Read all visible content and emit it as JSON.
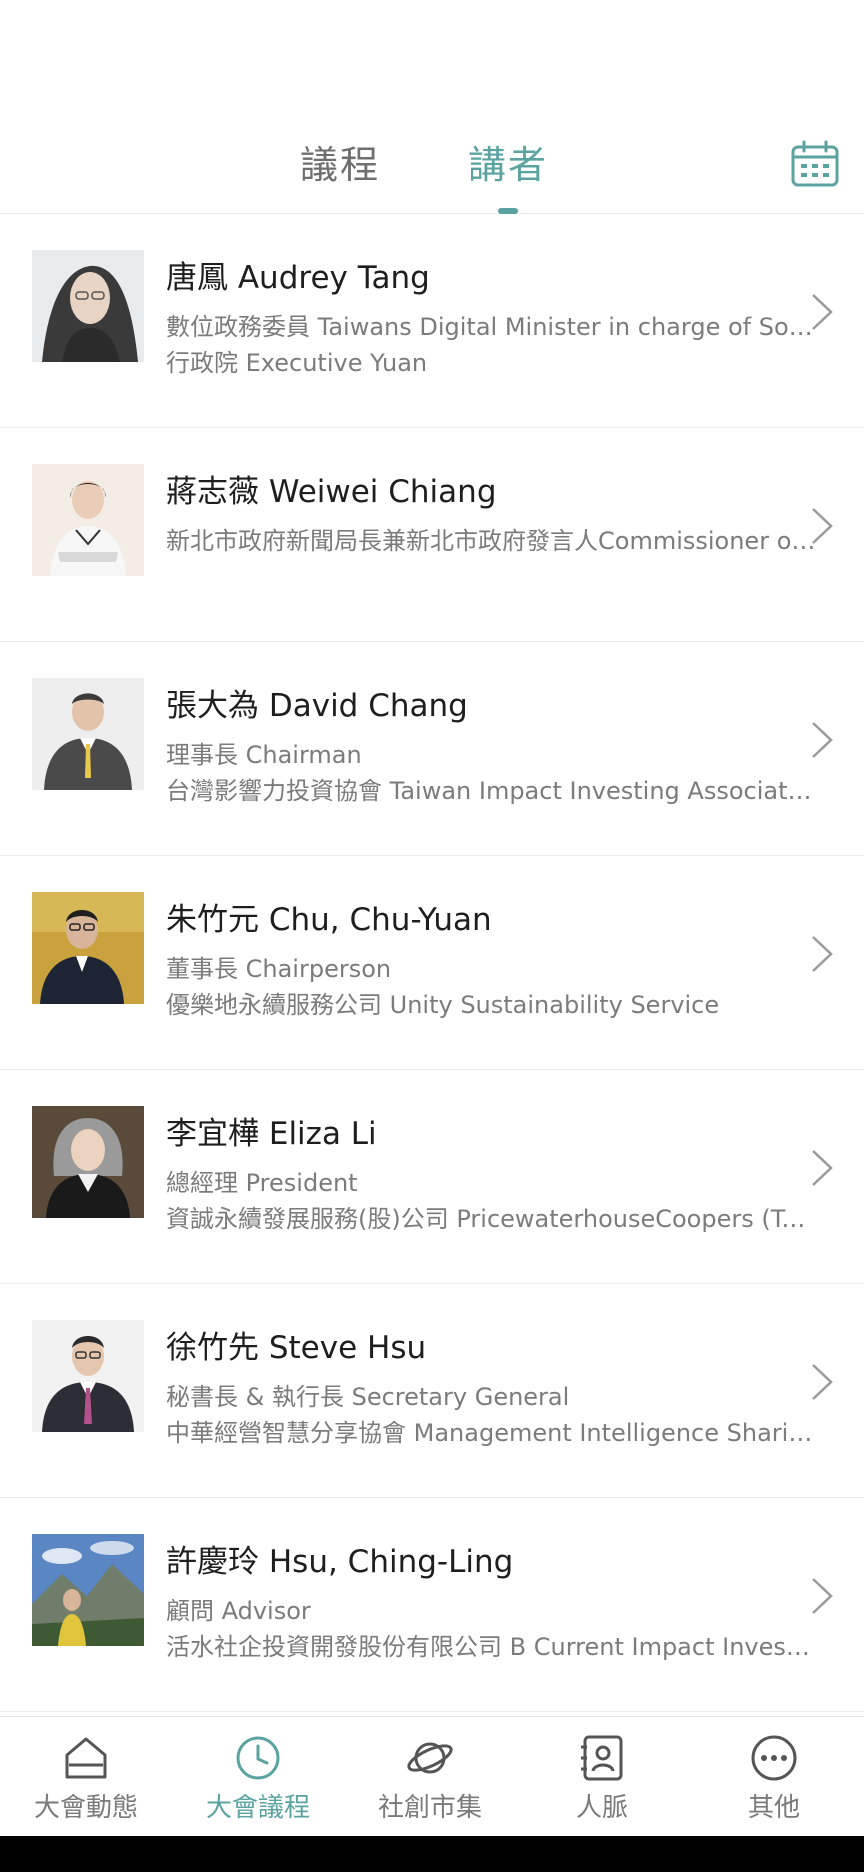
{
  "tabs": {
    "agenda": "議程",
    "speakers": "講者",
    "calendar_icon": "calendar-icon"
  },
  "colors": {
    "accent": "#5aa3a0",
    "text_primary": "#1e1e1e",
    "text_secondary": "#7b7b7b",
    "divider": "#ececec"
  },
  "speakers": [
    {
      "name": "唐鳳 Audrey Tang",
      "line1": "數位政務委員 Taiwans Digital Minister in charge of Social Innovation",
      "line2": "行政院 Executive Yuan"
    },
    {
      "name": "蔣志薇 Weiwei Chiang",
      "line1": "新北市政府新聞局長兼新北市政府發言人Commissioner of Information Department",
      "line2": ""
    },
    {
      "name": "張大為 David Chang",
      "line1": "理事長 Chairman",
      "line2": "台灣影響力投資協會 Taiwan Impact Investing Association"
    },
    {
      "name": "朱竹元 Chu, Chu-Yuan",
      "line1": "董事長 Chairperson",
      "line2": "優樂地永續服務公司 Unity Sustainability Service"
    },
    {
      "name": "李宜樺 Eliza Li",
      "line1": "總經理 President",
      "line2": "資誠永續發展服務(股)公司 PricewaterhouseCoopers (Taiwan)"
    },
    {
      "name": "徐竹先 Steve Hsu",
      "line1": "秘書長 & 執行長 Secretary General",
      "line2": "中華經營智慧分享協會 Management Intelligence Sharing Association"
    },
    {
      "name": "許慶玲 Hsu, Ching-Ling",
      "line1": "顧問 Advisor",
      "line2": "活水社企投資開發股份有限公司 B Current Impact Investment"
    }
  ],
  "bottom_nav": [
    {
      "label": "大會動態",
      "icon": "home-icon",
      "active": false
    },
    {
      "label": "大會議程",
      "icon": "clock-icon",
      "active": true
    },
    {
      "label": "社創市集",
      "icon": "planet-icon",
      "active": false
    },
    {
      "label": "人脈",
      "icon": "contacts-icon",
      "active": false
    },
    {
      "label": "其他",
      "icon": "more-icon",
      "active": false
    }
  ]
}
